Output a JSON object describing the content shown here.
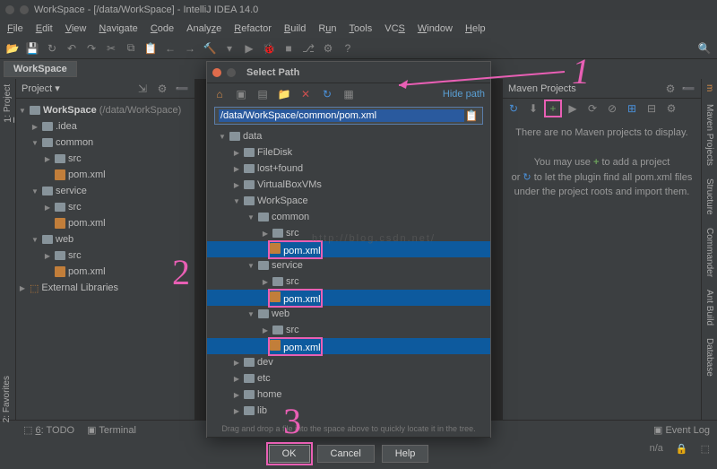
{
  "window": {
    "title": "WorkSpace - [/data/WorkSpace] - IntelliJ IDEA 14.0"
  },
  "menu": [
    "File",
    "Edit",
    "View",
    "Navigate",
    "Code",
    "Analyze",
    "Refactor",
    "Build",
    "Run",
    "Tools",
    "VCS",
    "Window",
    "Help"
  ],
  "workspace_tab": "WorkSpace",
  "project_panel": {
    "dropdown_label": "Project",
    "root": "WorkSpace",
    "root_path": "(/data/WorkSpace)",
    "nodes": [
      {
        "label": ".idea"
      },
      {
        "label": "common",
        "children": [
          {
            "label": "src"
          },
          {
            "label": "pom.xml",
            "file": true
          }
        ]
      },
      {
        "label": "service",
        "children": [
          {
            "label": "src"
          },
          {
            "label": "pom.xml",
            "file": true
          }
        ]
      },
      {
        "label": "web",
        "children": [
          {
            "label": "src"
          },
          {
            "label": "pom.xml",
            "file": true
          }
        ]
      }
    ],
    "external_libs": "External Libraries"
  },
  "maven_panel": {
    "title": "Maven Projects",
    "empty_msg": "There are no Maven projects to display.",
    "hint1": "You may use ",
    "hint1_plus": "+",
    "hint1_end": " to add a project",
    "hint2": "or ",
    "hint2_refresh": "↻",
    "hint2_end": " to let the plugin find all pom.xml files under the project roots and import them."
  },
  "right_tabs": [
    "m Maven Projects",
    "Structure",
    "Commander",
    "Ant Build",
    "Database"
  ],
  "left_tabs": [
    "1: Project"
  ],
  "left_bot_tab": "2: Favorites",
  "bottom_tabs": {
    "todo": "6: TODO",
    "terminal": "Terminal"
  },
  "status": {
    "event_log": "Event Log",
    "na": "n/a"
  },
  "dialog": {
    "title": "Select Path",
    "hide_path": "Hide path",
    "path_value": "/data/WorkSpace/common/pom.xml",
    "drag_hint": "Drag and drop a file into the space above to quickly locate it in the tree.",
    "ok": "OK",
    "cancel": "Cancel",
    "help": "Help",
    "tree": [
      {
        "label": "data",
        "depth": 0,
        "open": true
      },
      {
        "label": "FileDisk",
        "depth": 1
      },
      {
        "label": "lost+found",
        "depth": 1
      },
      {
        "label": "VirtualBoxVMs",
        "depth": 1
      },
      {
        "label": "WorkSpace",
        "depth": 1,
        "open": true
      },
      {
        "label": "common",
        "depth": 2,
        "open": true
      },
      {
        "label": "src",
        "depth": 3
      },
      {
        "label": "pom.xml",
        "depth": 3,
        "file": true,
        "sel": true,
        "pink": true
      },
      {
        "label": "service",
        "depth": 2,
        "open": true
      },
      {
        "label": "src",
        "depth": 3
      },
      {
        "label": "pom.xml",
        "depth": 3,
        "file": true,
        "sel": true,
        "pink": true
      },
      {
        "label": "web",
        "depth": 2,
        "open": true
      },
      {
        "label": "src",
        "depth": 3
      },
      {
        "label": "pom.xml",
        "depth": 3,
        "file": true,
        "sel": true,
        "pink": true
      },
      {
        "label": "dev",
        "depth": 1
      },
      {
        "label": "etc",
        "depth": 1
      },
      {
        "label": "home",
        "depth": 1
      },
      {
        "label": "lib",
        "depth": 1
      }
    ]
  },
  "annotations": {
    "one": "1",
    "two": "2",
    "three": "3"
  },
  "watermark": "http://blog.csdn.net/"
}
